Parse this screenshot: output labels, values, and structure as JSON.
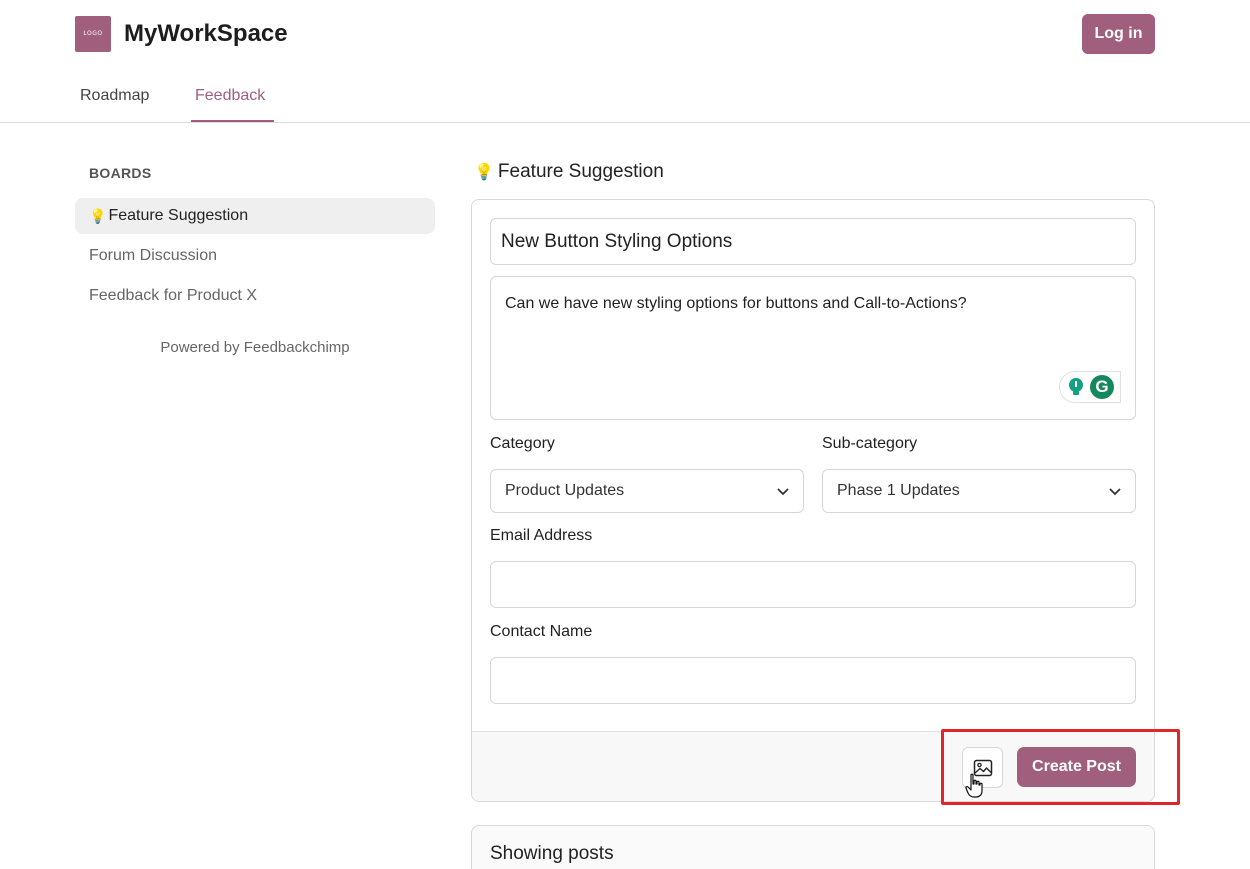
{
  "header": {
    "logo_text": "LOGO",
    "brand": "MyWorkSpace",
    "login_label": "Log in",
    "tabs": [
      {
        "label": "Roadmap",
        "active": false
      },
      {
        "label": "Feedback",
        "active": true
      }
    ]
  },
  "sidebar": {
    "heading": "BOARDS",
    "items": [
      {
        "label": "Feature Suggestion",
        "icon": "lightbulb-icon",
        "active": true
      },
      {
        "label": "Forum Discussion",
        "active": false
      },
      {
        "label": "Feedback for Product X",
        "active": false
      }
    ],
    "powered_by": "Powered by Feedbackchimp"
  },
  "main": {
    "board_title": "Feature Suggestion",
    "form": {
      "title_value": "New Button Styling Options",
      "description_value": "Can we have new styling options for buttons and Call-to-Actions?",
      "category_label": "Category",
      "category_value": "Product Updates",
      "subcategory_label": "Sub-category",
      "subcategory_value": "Phase 1 Updates",
      "email_label": "Email Address",
      "email_value": "",
      "contact_label": "Contact Name",
      "contact_value": "",
      "create_label": "Create Post"
    },
    "posts_heading": "Showing posts"
  },
  "colors": {
    "accent": "#a05f7c",
    "highlight": "#e0262b",
    "grammarly": "#15875f"
  }
}
